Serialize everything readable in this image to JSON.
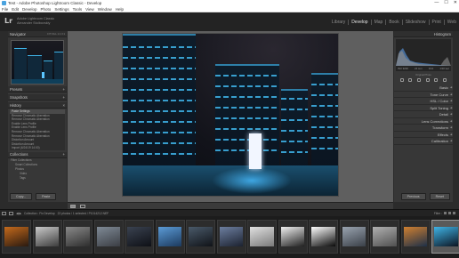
{
  "window": {
    "title": "Test - Adobe Photoshop Lightroom Classic - Develop",
    "controls": [
      "—",
      "☐",
      "✕"
    ]
  },
  "menu": [
    "File",
    "Edit",
    "Develop",
    "Photo",
    "Settings",
    "Tools",
    "View",
    "Window",
    "Help"
  ],
  "identity": {
    "logo": "Lr",
    "line1": "Adobe Lightroom Classic",
    "line2": "Alexander Stolbovskiy"
  },
  "modules": [
    {
      "label": "Library",
      "active": false
    },
    {
      "label": "Develop",
      "active": true
    },
    {
      "label": "Map",
      "active": false
    },
    {
      "label": "Book",
      "active": false
    },
    {
      "label": "Slideshow",
      "active": false
    },
    {
      "label": "Print",
      "active": false
    },
    {
      "label": "Web",
      "active": false
    }
  ],
  "left_panel": {
    "navigator": {
      "label": "Navigator",
      "zoom": "FIT  FILL  1:1  3:1"
    },
    "presets": "Presets",
    "snapshots": "Snapshots",
    "history": {
      "label": "History",
      "items": [
        "Paste Settings",
        "Remove Chromatic Aberration",
        "Remove Chromatic Aberration",
        "Enable Lens Profile",
        "Enable Lens Profile",
        "Remove Chromatic Aberration",
        "Remove Chromatic Aberration",
        "Distortion Amount",
        "Distortion Amount",
        "Import (6/24/19 14:00)"
      ],
      "active_index": 0
    },
    "collections": {
      "label": "Collections",
      "items": [
        {
          "label": "Filter Collections",
          "level": 0
        },
        {
          "label": "Smart Collections",
          "level": 1
        },
        {
          "label": "Photos",
          "level": 1
        },
        {
          "label": "Video",
          "level": 2
        },
        {
          "label": "Tags",
          "level": 2
        }
      ]
    },
    "copy_btn": "Copy...",
    "paste_btn": "Paste"
  },
  "right_panel": {
    "histogram": "Histogram",
    "histo_info": [
      "ISO 3200",
      "24 mm",
      "f/4.0",
      "1/10 sec"
    ],
    "original_photo": "Original Photo",
    "sections": [
      "Basic",
      "Tone Curve",
      "HSL / Color",
      "Split Toning",
      "Detail",
      "Lens Corrections",
      "Transform",
      "Effects",
      "Calibration"
    ],
    "previous_btn": "Previous",
    "reset_btn": "Reset"
  },
  "filmstrip_bar": {
    "source": "Collection : Fix Develop",
    "count": "22 photos / 1 selected / P1014212.NEF",
    "filter_label": "Filter :"
  },
  "filmstrip": {
    "thumbnails": [
      {
        "name": "thumb-fire-portrait",
        "c1": "#c46a1c",
        "c2": "#2a1a10"
      },
      {
        "name": "thumb-staircase",
        "c1": "#c9c9c9",
        "c2": "#3d3d3d"
      },
      {
        "name": "thumb-street-gray",
        "c1": "#8a8a8a",
        "c2": "#2e2e2e"
      },
      {
        "name": "thumb-city-river",
        "c1": "#7f8a96",
        "c2": "#3b3e44"
      },
      {
        "name": "thumb-night-shore",
        "c1": "#3a4250",
        "c2": "#0e1016"
      },
      {
        "name": "thumb-blue-harbor",
        "c1": "#5b9bd6",
        "c2": "#1c3a5e"
      },
      {
        "name": "thumb-night-street",
        "c1": "#4a5a6a",
        "c2": "#101318"
      },
      {
        "name": "thumb-neon-arcade",
        "c1": "#6d7fa0",
        "c2": "#1c2230"
      },
      {
        "name": "thumb-white-fog",
        "c1": "#e0e0e0",
        "c2": "#7a7a7a"
      },
      {
        "name": "thumb-bw-figure",
        "c1": "#f0f0f0",
        "c2": "#202020"
      },
      {
        "name": "thumb-circle-lights",
        "c1": "#ffffff",
        "c2": "#0a0a0a"
      },
      {
        "name": "thumb-wet-road",
        "c1": "#9aa4b0",
        "c2": "#3a4048"
      },
      {
        "name": "thumb-gray-street",
        "c1": "#b0b0b0",
        "c2": "#505050"
      },
      {
        "name": "thumb-orange-crowd",
        "c1": "#d08030",
        "c2": "#1e3048"
      },
      {
        "name": "thumb-current-city",
        "c1": "#3fb3e6",
        "c2": "#0c1522"
      }
    ],
    "selected_index": 14
  }
}
